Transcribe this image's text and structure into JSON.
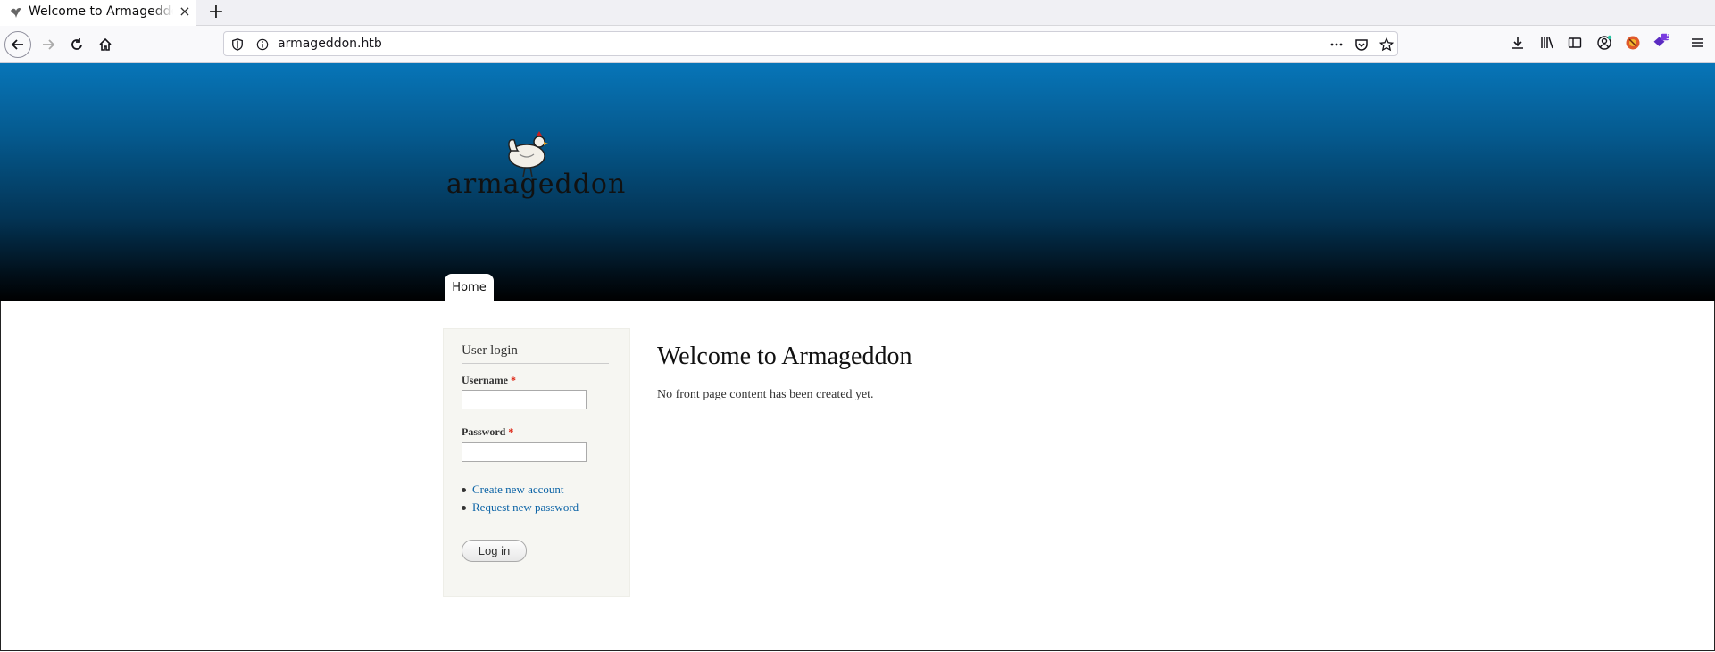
{
  "browser": {
    "tab_title": "Welcome to Armageddon",
    "new_tab": "+",
    "close": "×",
    "url": "armageddon.htb",
    "badge": "5"
  },
  "site": {
    "logo_text": "armageddon",
    "nav_home": "Home",
    "login_block": {
      "title": "User login",
      "username_label": "Username",
      "password_label": "Password",
      "required_marker": "*",
      "links": [
        "Create new account",
        "Request new password"
      ],
      "login_button": "Log in"
    },
    "main": {
      "title": "Welcome to Armageddon",
      "text": "No front page content has been created yet."
    }
  },
  "colors": {
    "header_top": "#0775b8",
    "header_bottom": "#000000",
    "link": "#0b63a6",
    "required": "#dd2211"
  },
  "icons": [
    "back-icon",
    "forward-icon",
    "reload-icon",
    "home-icon",
    "shield-icon",
    "info-icon",
    "more-icon",
    "pocket-icon",
    "star-icon",
    "download-icon",
    "library-icon",
    "sidebar-icon",
    "account-icon",
    "extension-icon",
    "extension-badge-icon",
    "menu-icon",
    "chicken-logo-icon"
  ]
}
